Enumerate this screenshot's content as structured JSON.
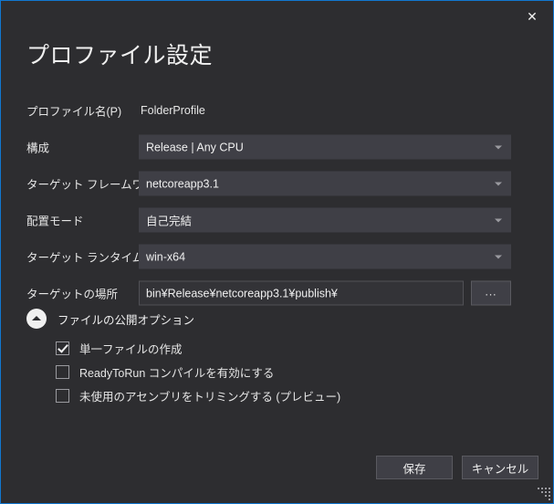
{
  "window": {
    "title": "プロファイル設定",
    "close_label": "✕",
    "accent_color": "#1177d1",
    "background_color": "#2d2d30",
    "field_color": "#3f3f46"
  },
  "form": {
    "profile_name": {
      "label": "プロファイル名(P)",
      "value": "FolderProfile"
    },
    "configuration": {
      "label": "構成",
      "value": "Release | Any CPU"
    },
    "target_framework": {
      "label": "ターゲット フレームワーク",
      "value": "netcoreapp3.1"
    },
    "deployment_mode": {
      "label": "配置モード",
      "value": "自己完結"
    },
    "target_runtime": {
      "label": "ターゲット ランタイム",
      "value": "win-x64"
    },
    "target_location": {
      "label": "ターゲットの場所",
      "value": "bin¥Release¥netcoreapp3.1¥publish¥",
      "browse_label": "..."
    }
  },
  "file_publish_options": {
    "section_label": "ファイルの公開オプション",
    "expanded": true,
    "checkboxes": [
      {
        "label": "単一ファイルの作成",
        "checked": true
      },
      {
        "label": "ReadyToRun コンパイルを有効にする",
        "checked": false
      },
      {
        "label": "未使用のアセンブリをトリミングする (プレビュー)",
        "checked": false
      }
    ]
  },
  "footer": {
    "save_label": "保存",
    "cancel_label": "キャンセル"
  }
}
